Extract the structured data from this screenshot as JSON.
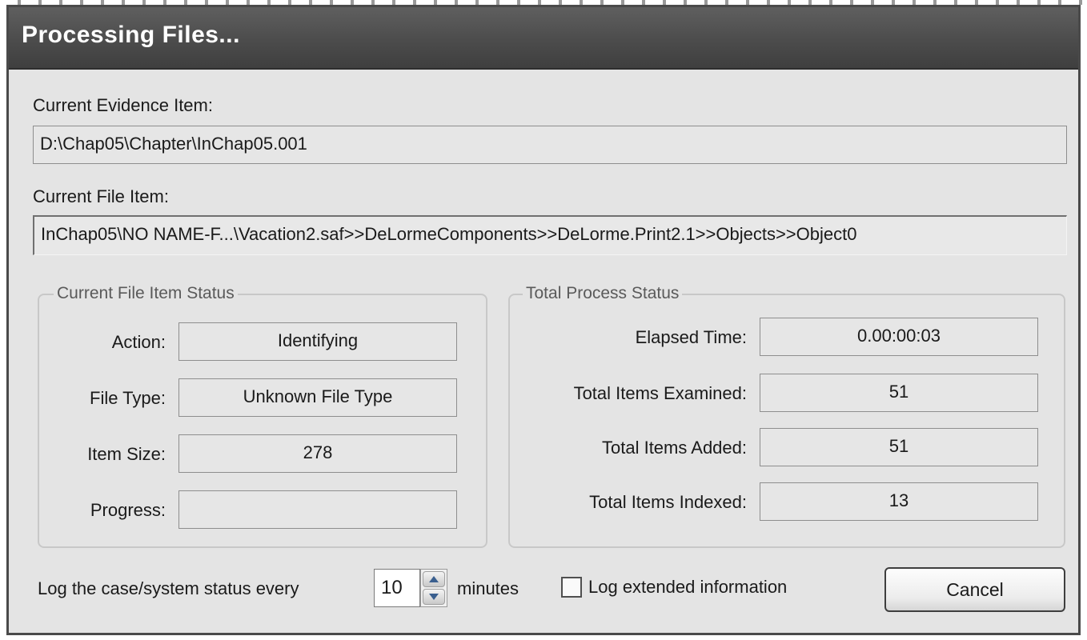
{
  "window": {
    "title": "Processing Files..."
  },
  "evidence": {
    "label": "Current Evidence Item:",
    "value": "D:\\Chap05\\Chapter\\InChap05.001"
  },
  "file_item": {
    "label": "Current File Item:",
    "value": "InChap05\\NO NAME-F...\\Vacation2.saf>>DeLormeComponents>>DeLorme.Print2.1>>Objects>>Object0"
  },
  "file_status": {
    "legend": "Current File Item Status",
    "action_label": "Action:",
    "action_value": "Identifying",
    "file_type_label": "File Type:",
    "file_type_value": "Unknown File Type",
    "item_size_label": "Item Size:",
    "item_size_value": "278",
    "progress_label": "Progress:",
    "progress_value": ""
  },
  "total_status": {
    "legend": "Total Process Status",
    "elapsed_label": "Elapsed Time:",
    "elapsed_value": "0.00:00:03",
    "examined_label": "Total Items Examined:",
    "examined_value": "51",
    "added_label": "Total Items Added:",
    "added_value": "51",
    "indexed_label": "Total Items Indexed:",
    "indexed_value": "13"
  },
  "footer": {
    "log_label": "Log the case/system status every",
    "interval_value": "10",
    "minutes_label": "minutes",
    "extended_label": "Log extended information",
    "extended_checked": false,
    "cancel_label": "Cancel"
  }
}
